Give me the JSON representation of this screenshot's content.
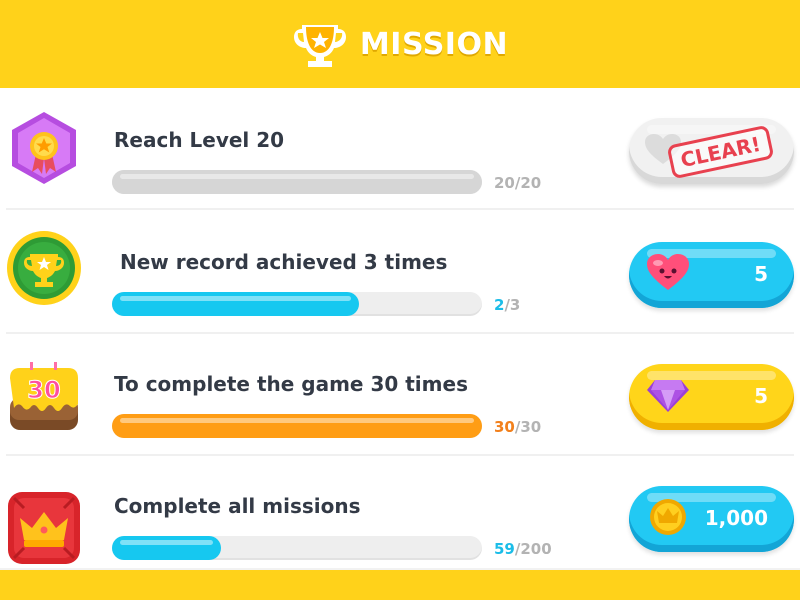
{
  "header": {
    "title": "MISSION",
    "icon": "trophy-icon"
  },
  "missions": [
    {
      "title": "Reach Level 20",
      "current": "20",
      "total": "/20",
      "progress": 1.0,
      "bar_color": "gray",
      "icon": "medal-badge-icon",
      "reward": {
        "state": "claimed",
        "stamp": "CLEAR!",
        "icon": "heart-icon"
      }
    },
    {
      "title": "New record achieved 3 times",
      "current": "2",
      "total": "/3",
      "progress": 0.6667,
      "bar_color": "blue",
      "icon": "trophy-badge-icon",
      "reward": {
        "state": "available",
        "value": "5",
        "icon": "heart-icon",
        "color": "blue"
      }
    },
    {
      "title": "To complete the game 30 times",
      "current": "30",
      "total": "/30",
      "progress": 1.0,
      "bar_color": "orange",
      "icon": "cake-30-icon",
      "reward": {
        "state": "available",
        "value": "5",
        "icon": "gem-icon",
        "color": "yellow"
      }
    },
    {
      "title": "Complete all missions",
      "current": "59",
      "total": "/200",
      "progress": 0.295,
      "bar_color": "blue",
      "icon": "crown-badge-icon",
      "reward": {
        "state": "available",
        "value": "1,000",
        "icon": "coin-icon",
        "color": "blue"
      }
    }
  ],
  "colors": {
    "header_yellow": "#ffd21a",
    "progress_blue": "#16c8f0",
    "progress_orange": "#ff9d14",
    "current_blue": "#1bbde8",
    "current_orange": "#f2801c",
    "stamp_red": "#e8414f"
  }
}
